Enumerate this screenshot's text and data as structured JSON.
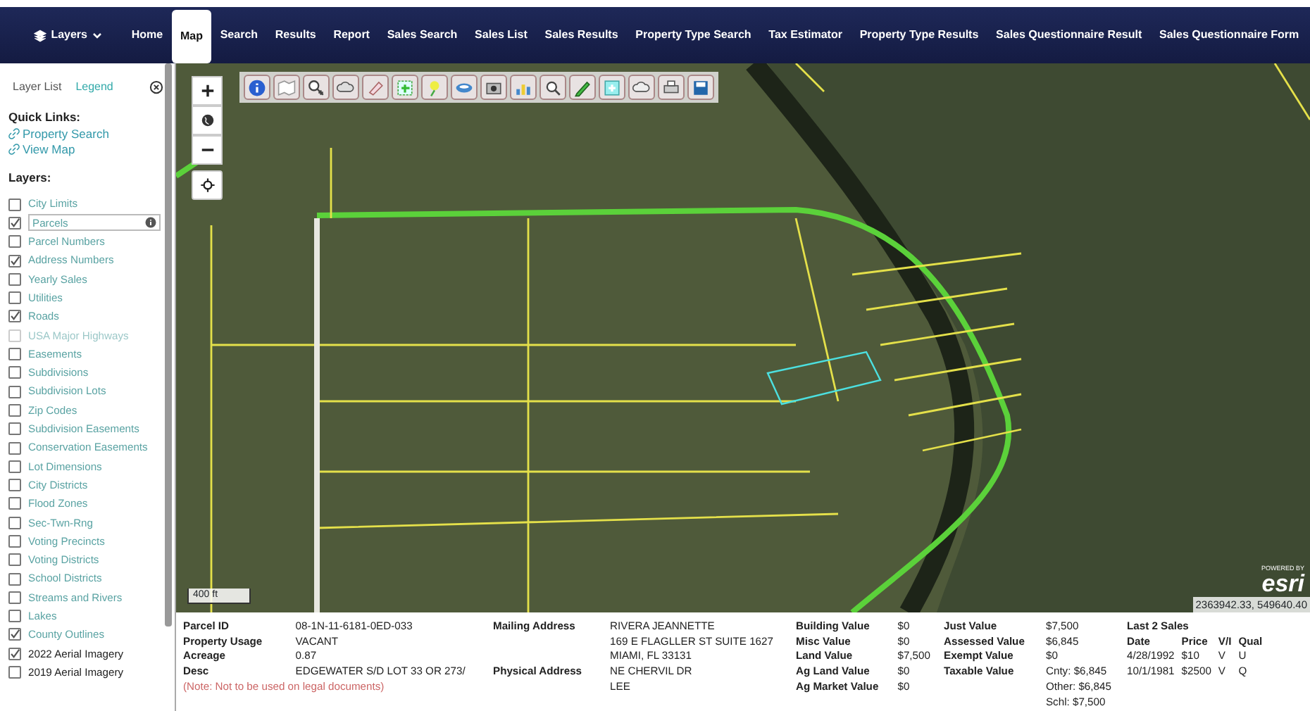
{
  "nav": {
    "layers_menu": {
      "label": "Layers"
    },
    "items": [
      {
        "label": "Home",
        "selected": false
      },
      {
        "label": "Map",
        "selected": true
      },
      {
        "label": "Search",
        "selected": false
      },
      {
        "label": "Results",
        "selected": false
      },
      {
        "label": "Report",
        "selected": false
      },
      {
        "label": "Sales Search",
        "selected": false
      },
      {
        "label": "Sales List",
        "selected": false
      },
      {
        "label": "Sales Results",
        "selected": false
      },
      {
        "label": "Property Type Search",
        "selected": false
      },
      {
        "label": "Tax Estimator",
        "selected": false
      },
      {
        "label": "Property Type Results",
        "selected": false
      },
      {
        "label": "Sales Questionnaire Result",
        "selected": false
      },
      {
        "label": "Sales Questionnaire Form",
        "selected": false
      }
    ]
  },
  "sidebar": {
    "tabs": [
      {
        "label": "Layer List",
        "selected": true
      },
      {
        "label": "Legend",
        "selected": false
      }
    ],
    "quick_links_title": "Quick Links:",
    "quick_links": [
      "Property Search",
      "View Map"
    ],
    "layers_title": "Layers:",
    "layers": [
      {
        "label": "City Limits",
        "checked": false,
        "dimmed": true,
        "disabled": false,
        "selected": false
      },
      {
        "label": "Parcels",
        "checked": true,
        "dimmed": true,
        "disabled": false,
        "selected": true
      },
      {
        "label": "Parcel Numbers",
        "checked": false,
        "dimmed": true,
        "disabled": false,
        "selected": false
      },
      {
        "label": "Address Numbers",
        "checked": true,
        "dimmed": true,
        "disabled": false,
        "selected": false
      },
      {
        "label": "Yearly Sales",
        "checked": false,
        "dimmed": true,
        "disabled": false,
        "selected": false
      },
      {
        "label": "Utilities",
        "checked": false,
        "dimmed": true,
        "disabled": false,
        "selected": false
      },
      {
        "label": "Roads",
        "checked": true,
        "dimmed": true,
        "disabled": false,
        "selected": false
      },
      {
        "label": "USA Major Highways",
        "checked": false,
        "dimmed": true,
        "disabled": true,
        "selected": false
      },
      {
        "label": "Easements",
        "checked": false,
        "dimmed": true,
        "disabled": false,
        "selected": false
      },
      {
        "label": "Subdivisions",
        "checked": false,
        "dimmed": true,
        "disabled": false,
        "selected": false
      },
      {
        "label": "Subdivision Lots",
        "checked": false,
        "dimmed": true,
        "disabled": false,
        "selected": false
      },
      {
        "label": "Zip Codes",
        "checked": false,
        "dimmed": true,
        "disabled": false,
        "selected": false
      },
      {
        "label": "Subdivision Easements",
        "checked": false,
        "dimmed": true,
        "disabled": false,
        "selected": false
      },
      {
        "label": "Conservation Easements",
        "checked": false,
        "dimmed": true,
        "disabled": false,
        "selected": false
      },
      {
        "label": "Lot Dimensions",
        "checked": false,
        "dimmed": true,
        "disabled": false,
        "selected": false
      },
      {
        "label": "City Districts",
        "checked": false,
        "dimmed": true,
        "disabled": false,
        "selected": false
      },
      {
        "label": "Flood Zones",
        "checked": false,
        "dimmed": true,
        "disabled": false,
        "selected": false
      },
      {
        "label": "Sec-Twn-Rng",
        "checked": false,
        "dimmed": true,
        "disabled": false,
        "selected": false
      },
      {
        "label": "Voting Precincts",
        "checked": false,
        "dimmed": true,
        "disabled": false,
        "selected": false
      },
      {
        "label": "Voting Districts",
        "checked": false,
        "dimmed": true,
        "disabled": false,
        "selected": false
      },
      {
        "label": "School Districts",
        "checked": false,
        "dimmed": true,
        "disabled": false,
        "selected": false
      },
      {
        "label": "Streams and Rivers",
        "checked": false,
        "dimmed": true,
        "disabled": false,
        "selected": false
      },
      {
        "label": "Lakes",
        "checked": false,
        "dimmed": true,
        "disabled": false,
        "selected": false
      },
      {
        "label": "County Outlines",
        "checked": true,
        "dimmed": true,
        "disabled": false,
        "selected": false
      },
      {
        "label": "2022 Aerial Imagery",
        "checked": true,
        "dimmed": false,
        "disabled": false,
        "selected": false
      },
      {
        "label": "2019 Aerial Imagery",
        "checked": false,
        "dimmed": false,
        "disabled": false,
        "selected": false
      }
    ]
  },
  "map": {
    "scale": "400 ft",
    "coordinates": "2363942.33, 549640.40",
    "attribution": "POWERED BY",
    "logo": "esri"
  },
  "info": {
    "groups": [
      {
        "rows": [
          {
            "label": "Parcel ID",
            "values": [
              "08-1N-11-6181-0ED-033"
            ]
          },
          {
            "label": "Property Usage",
            "values": [
              "VACANT"
            ]
          },
          {
            "label": "Acreage",
            "values": [
              "0.87"
            ]
          },
          {
            "label": "Desc",
            "values": [
              "EDGEWATER S/D LOT 33 OR 273/"
            ]
          }
        ],
        "note": "(Note: Not to be used on legal documents)"
      },
      {
        "rows": [
          {
            "label": "Mailing Address",
            "values": [
              "RIVERA JEANNETTE",
              "169 E FLAGLLER ST SUITE 1627",
              "MIAMI, FL 33131"
            ]
          },
          {
            "label": "Physical Address",
            "values": [
              "NE CHERVIL DR",
              "LEE"
            ]
          }
        ]
      },
      {
        "rows": [
          {
            "label": "Building Value",
            "values": [
              "$0"
            ]
          },
          {
            "label": "Misc Value",
            "values": [
              "$0"
            ]
          },
          {
            "label": "Land Value",
            "values": [
              "$7,500"
            ]
          },
          {
            "label": "Ag Land Value",
            "values": [
              "$0"
            ]
          },
          {
            "label": "Ag Market Value",
            "values": [
              "$0"
            ]
          }
        ]
      },
      {
        "rows": [
          {
            "label": "Just Value",
            "values": [
              "$7,500"
            ]
          },
          {
            "label": "Assessed Value",
            "values": [
              "$6,845"
            ]
          },
          {
            "label": "Exempt Value",
            "values": [
              "$0"
            ]
          },
          {
            "label": "Taxable Value",
            "values": [
              "Cnty: $6,845",
              "Other: $6,845",
              "Schl: $7,500"
            ]
          }
        ]
      }
    ],
    "sales": {
      "title": "Last 2 Sales",
      "columns": [
        "Date",
        "Price",
        "V/I",
        "Qual"
      ],
      "rows": [
        [
          "4/28/1992",
          "$10",
          "V",
          "U"
        ],
        [
          "10/1/1981",
          "$2500",
          "V",
          "Q"
        ]
      ]
    }
  }
}
